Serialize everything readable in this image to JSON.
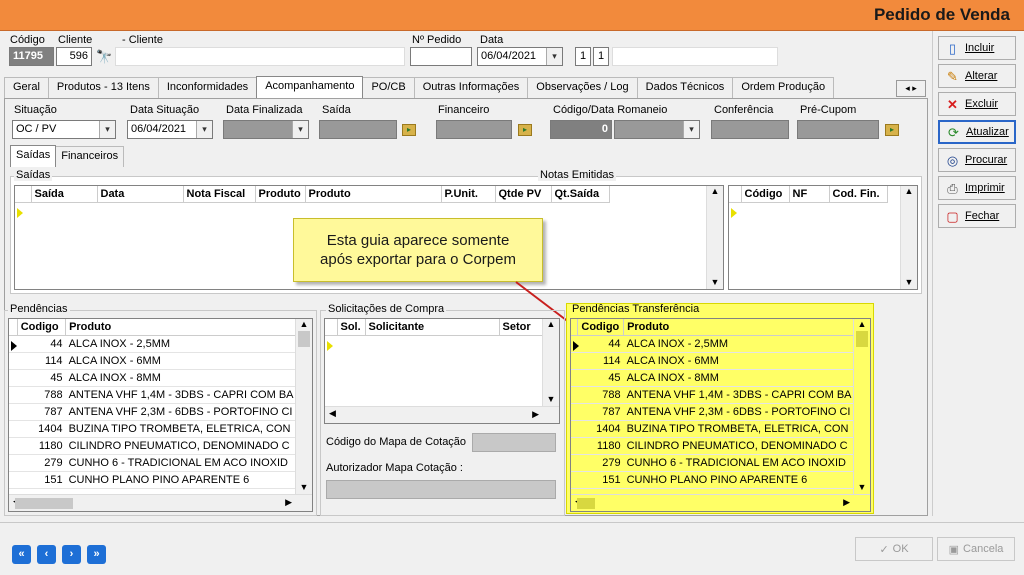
{
  "window": {
    "title": "Pedido de Venda"
  },
  "header": {
    "codigo_label": "Código",
    "codigo_value": "11795",
    "cliente_label": "Cliente",
    "cliente_value": "596",
    "cliente_name_label": "- Cliente",
    "pedido_label": "Nº Pedido",
    "pedido_value": "",
    "data_label": "Data",
    "data_value": "06/04/2021",
    "num1": "1",
    "num2": "1"
  },
  "tabs": [
    "Geral",
    "Produtos - 13 Itens",
    "Inconformidades",
    "Acompanhamento",
    "PO/CB",
    "Outras Informações",
    "Observações / Log",
    "Dados Técnicos",
    "Ordem Produção"
  ],
  "tabs_scroll": "◂ ▸",
  "fields": {
    "situacao_label": "Situação",
    "situacao_value": "OC / PV",
    "data_situacao_label": "Data Situação",
    "data_situacao_value": "06/04/2021",
    "data_finalizada_label": "Data Finalizada",
    "saida_label": "Saída",
    "financeiro_label": "Financeiro",
    "romaneio_label": "Código/Data Romaneio",
    "romaneio_value": "0",
    "conferencia_label": "Conferência",
    "precupom_label": "Pré-Cupom"
  },
  "subtabs": [
    "Saídas",
    "Financeiros"
  ],
  "saidas": {
    "group_label": "Saídas",
    "notas_label": "Notas Emitidas",
    "columns": [
      "Saída",
      "Data",
      "Nota Fiscal",
      "Produto",
      "Produto",
      "P.Unit.",
      "Qtde PV",
      "Qt.Saída"
    ],
    "notas_columns": [
      "Código",
      "NF",
      "Cod. Fin."
    ]
  },
  "callout": {
    "line1": "Esta guia aparece somente",
    "line2": "após exportar para o Corpem"
  },
  "pendencias": {
    "label": "Pendências",
    "columns": [
      "Codigo",
      "Produto"
    ],
    "rows": [
      {
        "code": "44",
        "name": "ALCA INOX - 2,5MM"
      },
      {
        "code": "114",
        "name": "ALCA INOX - 6MM"
      },
      {
        "code": "45",
        "name": "ALCA INOX - 8MM"
      },
      {
        "code": "788",
        "name": "ANTENA VHF 1,4M - 3DBS - CAPRI COM BA"
      },
      {
        "code": "787",
        "name": "ANTENA VHF 2,3M - 6DBS - PORTOFINO CI"
      },
      {
        "code": "1404",
        "name": "BUZINA TIPO TROMBETA, ELETRICA, CON"
      },
      {
        "code": "1180",
        "name": "CILINDRO PNEUMATICO, DENOMINADO C"
      },
      {
        "code": "279",
        "name": "CUNHO 6 - TRADICIONAL EM ACO INOXID"
      },
      {
        "code": "151",
        "name": "CUNHO PLANO PINO APARENTE 6"
      }
    ]
  },
  "solicitacoes": {
    "label": "Solicitações de Compra",
    "columns": [
      "Sol.",
      "Solicitante",
      "Setor"
    ],
    "mapa_label": "Código do Mapa de Cotação",
    "autorizador_label": "Autorizador Mapa Cotação :"
  },
  "transferencia": {
    "label": "Pendências Transferência",
    "columns": [
      "Codigo",
      "Produto"
    ],
    "rows": [
      {
        "code": "44",
        "name": "ALCA INOX - 2,5MM"
      },
      {
        "code": "114",
        "name": "ALCA INOX - 6MM"
      },
      {
        "code": "45",
        "name": "ALCA INOX - 8MM"
      },
      {
        "code": "788",
        "name": "ANTENA VHF 1,4M - 3DBS - CAPRI COM BA"
      },
      {
        "code": "787",
        "name": "ANTENA VHF 2,3M - 6DBS - PORTOFINO CI"
      },
      {
        "code": "1404",
        "name": "BUZINA TIPO TROMBETA, ELETRICA, CON"
      },
      {
        "code": "1180",
        "name": "CILINDRO PNEUMATICO, DENOMINADO C"
      },
      {
        "code": "279",
        "name": "CUNHO 6 - TRADICIONAL EM ACO INOXID"
      },
      {
        "code": "151",
        "name": "CUNHO PLANO PINO APARENTE 6"
      }
    ]
  },
  "side_buttons": [
    {
      "label": "Incluir",
      "icon": "document-icon"
    },
    {
      "label": "Alterar",
      "icon": "pencil-icon"
    },
    {
      "label": "Excluir",
      "icon": "x-icon"
    },
    {
      "label": "Atualizar",
      "icon": "refresh-icon"
    },
    {
      "label": "Procurar",
      "icon": "binoculars-icon"
    },
    {
      "label": "Imprimir",
      "icon": "printer-icon"
    },
    {
      "label": "Fechar",
      "icon": "door-icon"
    }
  ],
  "footer": {
    "ok_label": "OK",
    "cancel_label": "Cancela"
  },
  "colors": {
    "title_bar": "#f28a3c",
    "highlight": "#ffff66",
    "nav": "#1e6fd6"
  }
}
